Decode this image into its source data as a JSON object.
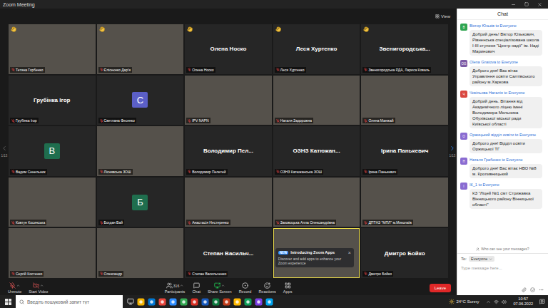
{
  "window": {
    "title": "Zoom Meeting"
  },
  "stage": {
    "view_label": "View",
    "page": "1/13"
  },
  "tiles": [
    {
      "kind": "video",
      "label": "Тетяна Горбенко",
      "hand_raised": true,
      "muted": true,
      "speaking": false
    },
    {
      "kind": "video",
      "label": "Єлісеєнко Дар'я",
      "hand_raised": true,
      "muted": true,
      "speaking": false
    },
    {
      "kind": "name",
      "title": "Олена Носко",
      "label": "Олена Носко",
      "hand_raised": true,
      "muted": true,
      "speaking": false
    },
    {
      "kind": "name",
      "title": "Леся Хуртенко",
      "label": "Леся Хуртенко",
      "hand_raised": true,
      "muted": true,
      "speaking": false
    },
    {
      "kind": "name",
      "title": "Звенигородська...",
      "label": "Звенигородська РДА, Лариса Коваль",
      "hand_raised": true,
      "muted": true,
      "speaking": false
    },
    {
      "kind": "name",
      "title": "Грубінка Ігор",
      "label": "Грубінка Ігор",
      "hand_raised": false,
      "muted": true,
      "speaking": false
    },
    {
      "kind": "avatar",
      "letter": "C",
      "color": "#5b5fc7",
      "label": "Светлана Фесенко",
      "hand_raised": false,
      "muted": true,
      "speaking": false
    },
    {
      "kind": "video",
      "label": "IPV NAPN",
      "hand_raised": false,
      "muted": true,
      "speaking": false
    },
    {
      "kind": "video",
      "label": "Наталя Задорожна",
      "hand_raised": false,
      "muted": true,
      "speaking": false
    },
    {
      "kind": "video",
      "label": "Олена Манжай",
      "hand_raised": false,
      "muted": true,
      "speaking": false
    },
    {
      "kind": "avatar",
      "letter": "B",
      "color": "#1f6e4e",
      "label": "Вадим Сенельник",
      "hand_raised": false,
      "muted": true,
      "speaking": false
    },
    {
      "kind": "video",
      "label": "Ліснявська ЗОШ",
      "hand_raised": false,
      "muted": true,
      "speaking": false
    },
    {
      "kind": "name",
      "title": "Володимир  Пел...",
      "label": "Володимир Пелетей",
      "hand_raised": false,
      "muted": true,
      "speaking": false
    },
    {
      "kind": "name",
      "title": "ОЗНЗ Катюжан...",
      "label": "ОЗНЗ Катюжанська ЗОШ",
      "hand_raised": false,
      "muted": true,
      "speaking": false
    },
    {
      "kind": "name",
      "title": "Ірина Панькевич",
      "label": "Ірина Панькевич",
      "hand_raised": false,
      "muted": true,
      "speaking": false
    },
    {
      "kind": "video",
      "label": "Ковтун Косинська",
      "hand_raised": false,
      "muted": true,
      "speaking": false
    },
    {
      "kind": "avatar",
      "letter": "Б",
      "color": "#1f6e4e",
      "label": "Богдан Вай",
      "hand_raised": false,
      "muted": true,
      "speaking": false
    },
    {
      "kind": "video",
      "label": "Анастасія Нестеренко",
      "hand_raised": false,
      "muted": true,
      "speaking": false
    },
    {
      "kind": "video",
      "label": "Заковоцька Алла Олександрівна",
      "hand_raised": false,
      "muted": true,
      "speaking": false
    },
    {
      "kind": "video",
      "label": "ДПТНЗ \"МПЛ\" м.Миколаїв",
      "hand_raised": false,
      "muted": true,
      "speaking": false
    },
    {
      "kind": "video",
      "label": "Сергій Костенко",
      "hand_raised": false,
      "muted": true,
      "speaking": false
    },
    {
      "kind": "video",
      "label": "Олександр",
      "hand_raised": false,
      "muted": true,
      "speaking": false
    },
    {
      "kind": "name",
      "title": "Степан  Васильч...",
      "label": "Степан Васильченко",
      "hand_raised": false,
      "muted": true,
      "speaking": false
    },
    {
      "kind": "video",
      "hand_raised": false,
      "muted": false,
      "speaking": true
    },
    {
      "kind": "name",
      "title": "Дмитро Бойко",
      "label": "Дмитро Бойко",
      "hand_raised": false,
      "muted": true,
      "speaking": false
    }
  ],
  "popup": {
    "badge": "NEW",
    "title": "Introducing Zoom Apps",
    "text": "Discover and add apps to enhance your Zoom experience",
    "close": "×"
  },
  "chat": {
    "title": "Chat",
    "messages": [
      {
        "avatar": "В",
        "color": "#2ea44f",
        "sender": "Віктор Юзьків to Everyone",
        "text": "Добрий день! Віктор Юзькович, Рівненська спеціалізована школа І-ІІІ ступеня \"Центр надії\" ім. Наді Маринович"
      },
      {
        "avatar": "OG",
        "color": "#7d5ba6",
        "sender": "Olena Gnatova to Everyone",
        "text": "Доброго дня! Вас вітає Управління освіти Салтівського району м.Харкова"
      },
      {
        "avatar": "Ч",
        "color": "#d9473f",
        "sender": "Чикільова Наталія to Everyone",
        "text": "Добрий день. Вітання від Академічного ліцею імені Володимира Мельника Обухівської міської ради Київської області"
      },
      {
        "avatar": "О",
        "color": "#8a6bd1",
        "sender": "Оржицький відділ освіти to Everyone",
        "text": "Доброго дня! Відділ освіти Оржицької ТГ"
      },
      {
        "avatar": "Н",
        "color": "#8a6bd1",
        "sender": "Наталя Грабенко to Everyone",
        "text": "Доброго дня! Вас вітає НВО №8 м. Кропивницький"
      },
      {
        "avatar": "І",
        "color": "#8a6bd1",
        "sender": "ІК_1 to Everyone",
        "text": "КЗ \"Ліцей №1 смт Стрижавка Вінницького району Вінницької області\""
      }
    ],
    "privacy_note": "Who can see your messages?",
    "to_label": "To:",
    "recipient": "Everyone",
    "input_placeholder": "Type message here..."
  },
  "toolbar": {
    "left": [
      {
        "label": "Unmute",
        "kind": "mic",
        "menu": true
      },
      {
        "label": "Start Video",
        "kind": "video",
        "menu": true
      }
    ],
    "center": [
      {
        "label": "Participants",
        "kind": "participants",
        "count": "316",
        "menu": true
      },
      {
        "label": "Chat",
        "kind": "chat",
        "menu": false
      },
      {
        "label": "Share Screen",
        "kind": "share",
        "menu": true
      },
      {
        "label": "Record",
        "kind": "record",
        "menu": false
      },
      {
        "label": "Reactions",
        "kind": "reactions",
        "menu": false
      },
      {
        "label": "Apps",
        "kind": "apps",
        "menu": false
      }
    ],
    "leave": "Leave"
  },
  "taskbar": {
    "search_placeholder": "Введіть пошуковий запит тут",
    "weather": "24°C Sunny",
    "time": "10:57",
    "date": "07.06.2022"
  }
}
